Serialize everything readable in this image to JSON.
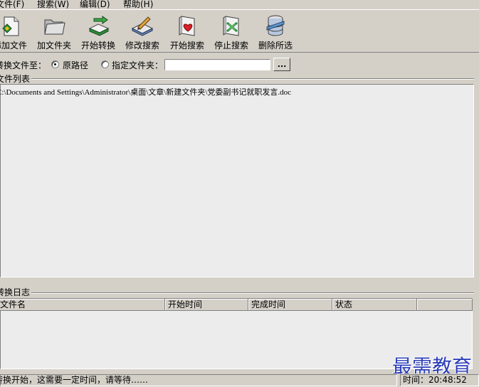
{
  "menubar": {
    "items": [
      {
        "label": "文件(F)"
      },
      {
        "label": "搜索(W)"
      },
      {
        "label": "编辑(D)"
      },
      {
        "label": "帮助(H)"
      }
    ]
  },
  "toolbar": {
    "buttons": [
      {
        "label": "添加文件",
        "icon": "add-file-icon"
      },
      {
        "label": "加文件夹",
        "icon": "add-folder-icon"
      },
      {
        "label": "开始转换",
        "icon": "convert-icon"
      },
      {
        "label": "修改搜索",
        "icon": "edit-search-icon"
      },
      {
        "label": "开始搜索",
        "icon": "search-icon"
      },
      {
        "label": "停止搜索",
        "icon": "stop-search-icon"
      },
      {
        "label": "删除所选",
        "icon": "delete-icon"
      }
    ]
  },
  "options": {
    "label": "转换文件至：",
    "radio_original": "原路径",
    "radio_specified": "指定文件夹：",
    "selected": "original",
    "folder_value": "",
    "browse_label": "..."
  },
  "file_list": {
    "title": "文件列表",
    "items": [
      "C:\\Documents and Settings\\Administrator\\桌面\\文章\\新建文件夹\\党委副书记就职发言.doc"
    ]
  },
  "log": {
    "title": "转换日志",
    "columns": [
      "文件名",
      "开始时间",
      "完成时间",
      "状态"
    ]
  },
  "status": {
    "message": "转换开始，这需要一定时间，请等待……",
    "time": "时间：20:48:52"
  },
  "watermark": "最需教育",
  "colors": {
    "window_bg": "#d4d0c8",
    "list_bg": "#ececec",
    "watermark": "#2d3fb8"
  }
}
